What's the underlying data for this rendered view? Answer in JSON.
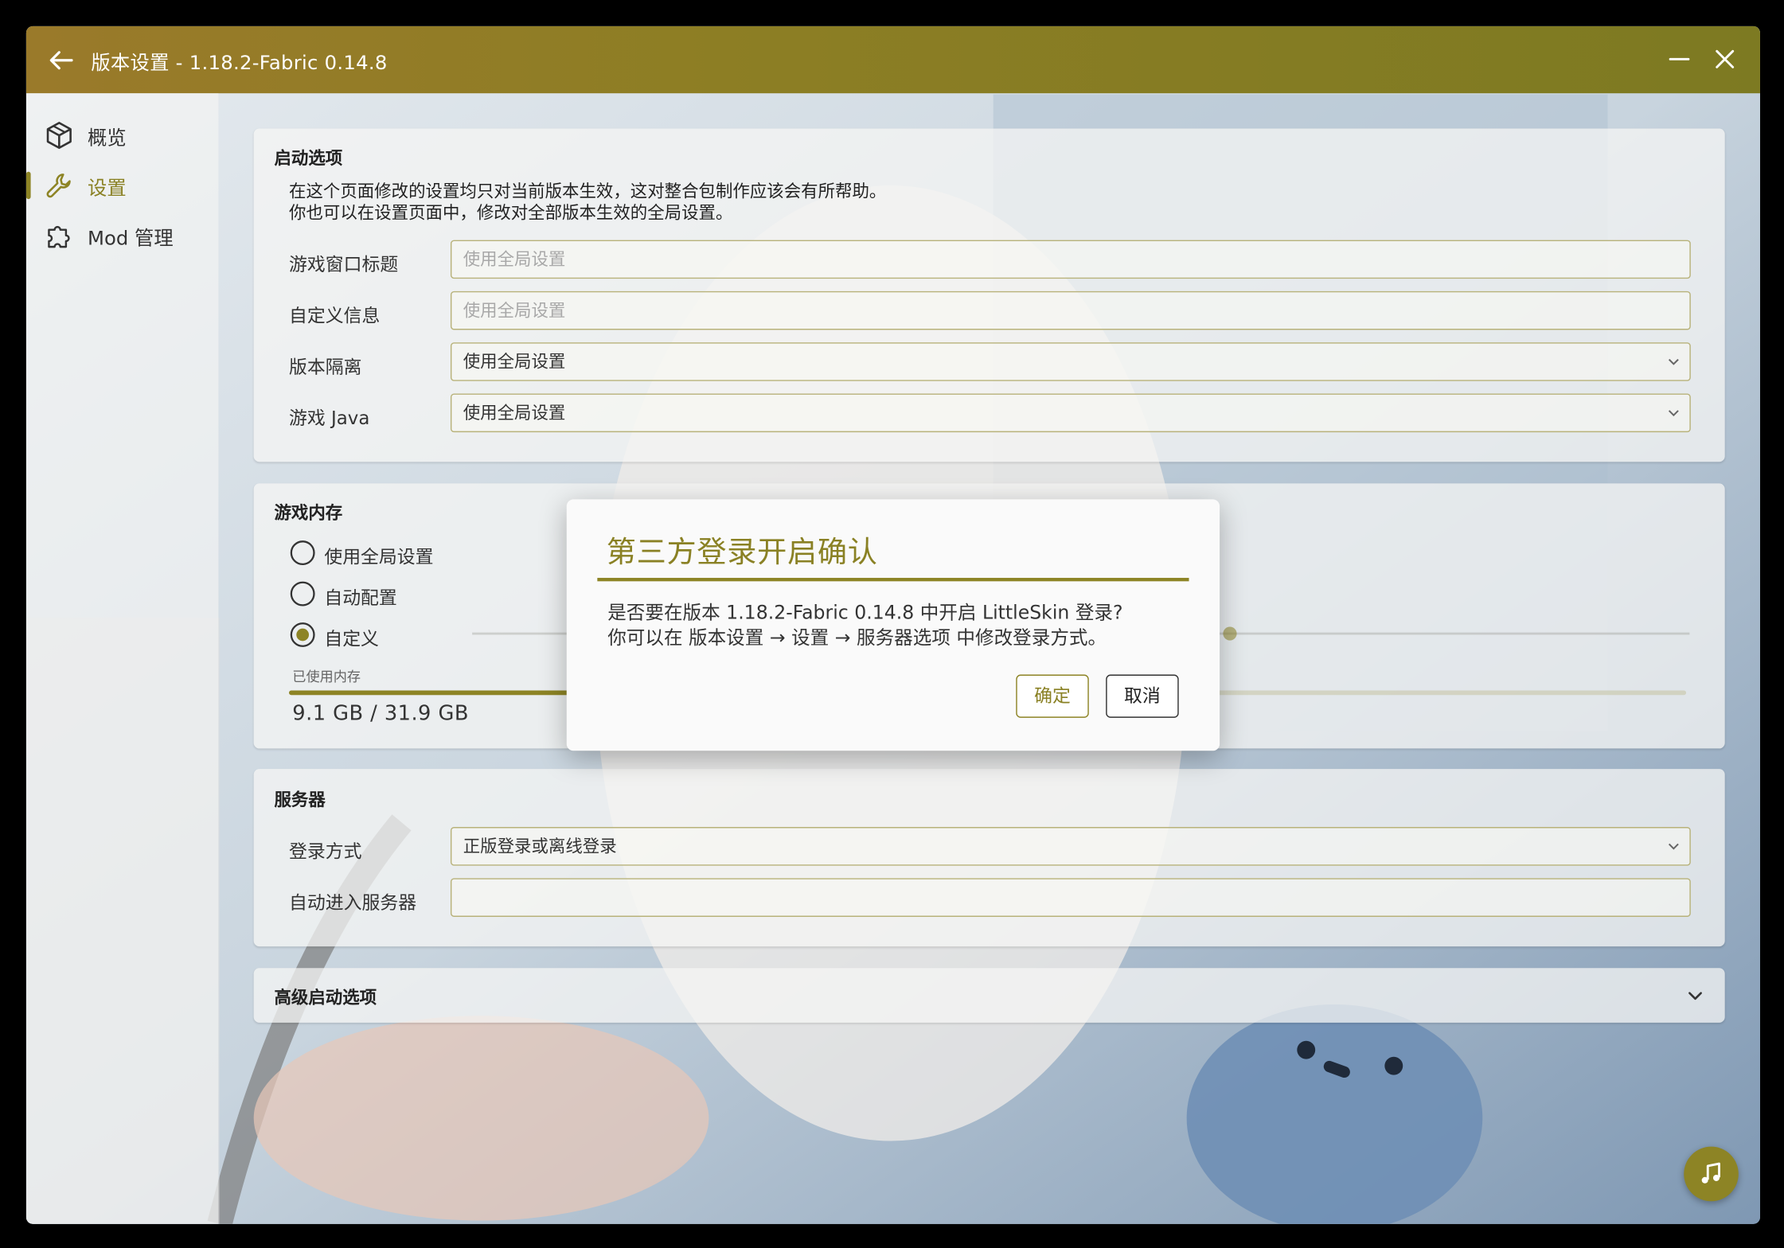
{
  "window": {
    "title": "版本设置 - 1.18.2-Fabric 0.14.8"
  },
  "sidebar": {
    "items": [
      {
        "label": "概览",
        "icon": "cube-icon"
      },
      {
        "label": "设置",
        "icon": "wrench-icon",
        "active": true
      },
      {
        "label": "Mod 管理",
        "icon": "puzzle-icon"
      }
    ]
  },
  "launch_options": {
    "title": "启动选项",
    "desc_line1": "在这个页面修改的设置均只对当前版本生效，这对整合包制作应该会有所帮助。",
    "desc_line2": "你也可以在设置页面中，修改对全部版本生效的全局设置。",
    "rows": [
      {
        "label": "游戏窗口标题",
        "value": "",
        "placeholder": "使用全局设置",
        "type": "text"
      },
      {
        "label": "自定义信息",
        "value": "",
        "placeholder": "使用全局设置",
        "type": "text"
      },
      {
        "label": "版本隔离",
        "value": "使用全局设置",
        "type": "select"
      },
      {
        "label": "游戏 Java",
        "value": "使用全局设置",
        "type": "select"
      }
    ]
  },
  "memory": {
    "title": "游戏内存",
    "options": [
      {
        "label": "使用全局设置",
        "selected": false
      },
      {
        "label": "自动配置",
        "selected": false
      },
      {
        "label": "自定义",
        "selected": true
      }
    ],
    "used_label": "已使用内存",
    "used_value": "9.1 GB / 31.9 GB",
    "used_fraction": 0.285
  },
  "server": {
    "title": "服务器",
    "rows": [
      {
        "label": "登录方式",
        "value": "正版登录或离线登录",
        "type": "select"
      },
      {
        "label": "自动进入服务器",
        "value": "",
        "type": "text"
      }
    ]
  },
  "advanced": {
    "title": "高级启动选项"
  },
  "dialog": {
    "title": "第三方登录开启确认",
    "message_line1": "是否要在版本 1.18.2-Fabric 0.14.8 中开启 LittleSkin 登录?",
    "message_line2": "你可以在 版本设置 → 设置 → 服务器选项 中修改登录方式。",
    "ok_label": "确定",
    "cancel_label": "取消"
  },
  "colors": {
    "accent": "#8d8425",
    "titlebar": "#8d7e24"
  }
}
